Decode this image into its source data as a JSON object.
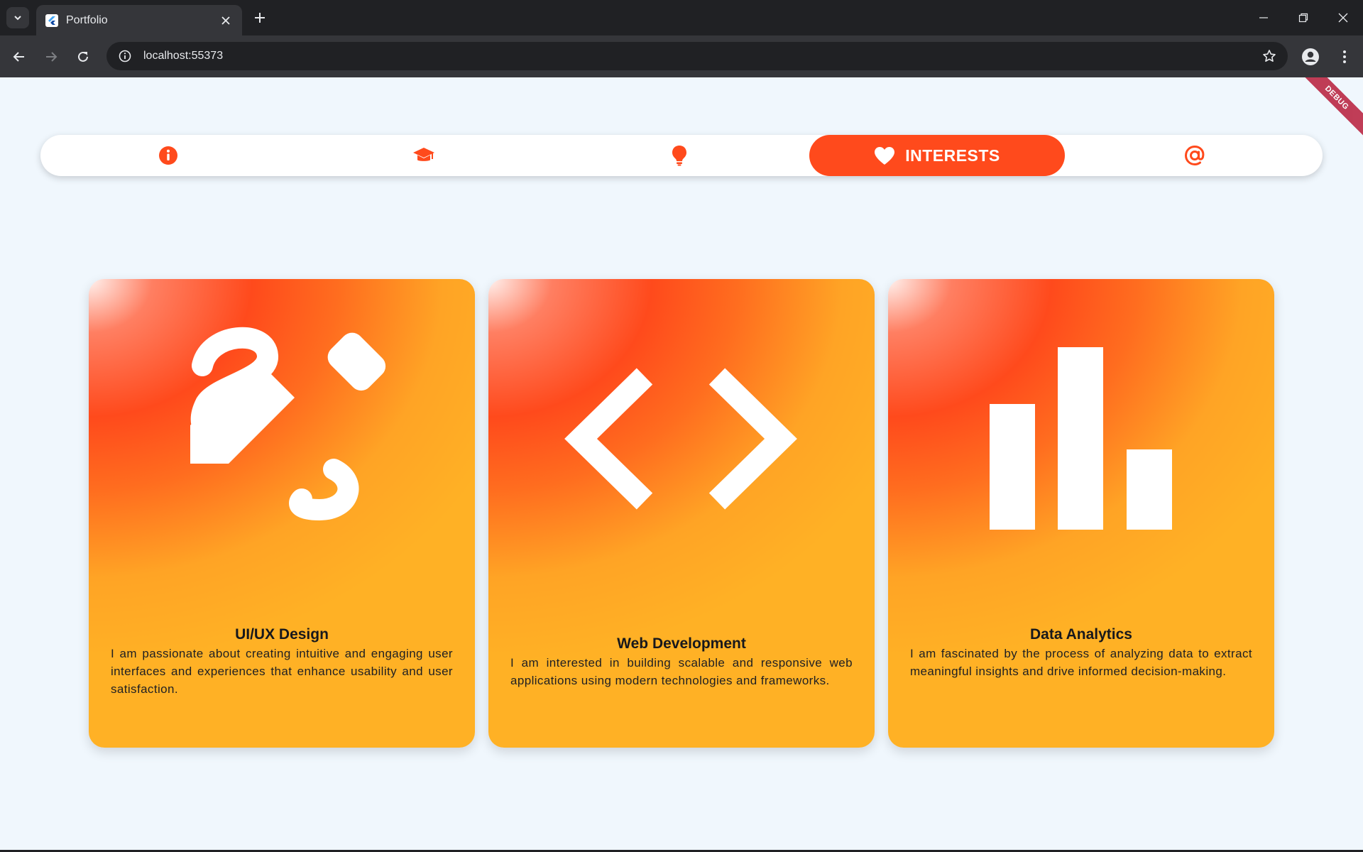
{
  "browser": {
    "tab_title": "Portfolio",
    "url": "localhost:55373"
  },
  "debug_banner": "DEBUG",
  "nav": {
    "items": [
      {
        "icon": "info-icon",
        "label": ""
      },
      {
        "icon": "graduation-cap-icon",
        "label": ""
      },
      {
        "icon": "lightbulb-icon",
        "label": ""
      },
      {
        "icon": "heart-icon",
        "label": "INTERESTS",
        "active": true
      },
      {
        "icon": "at-sign-icon",
        "label": ""
      }
    ]
  },
  "colors": {
    "accent": "#ff4a1c",
    "card_gradient_end": "#ffb125",
    "page_background": "#f0f7fd"
  },
  "cards": [
    {
      "icon": "pencil-design-icon",
      "title": "UI/UX Design",
      "description": "I am passionate about creating intuitive and engaging user interfaces and experiences that enhance usability and user satisfaction."
    },
    {
      "icon": "code-icon",
      "title": "Web Development",
      "description": "I am interested in building scalable and responsive web applications using modern technologies and frameworks."
    },
    {
      "icon": "bar-chart-icon",
      "title": "Data Analytics",
      "description": "I am fascinated by the process of analyzing data to extract meaningful insights and drive informed decision-making."
    }
  ]
}
